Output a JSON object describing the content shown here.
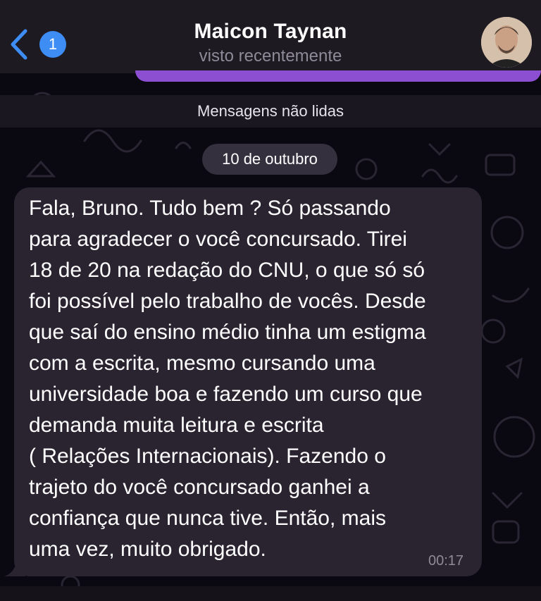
{
  "header": {
    "back_badge": "1",
    "contact_name": "Maicon Taynan",
    "status": "visto recentemente"
  },
  "chat": {
    "unread_divider": "Mensagens não lidas",
    "date": "10 de outubro",
    "message": {
      "lines": [
        "Fala, Bruno. Tudo bem ? Só passando",
        "para agradecer o você concursado. Tirei",
        "18 de 20 na redação do CNU, o que só só",
        "foi possível pelo trabalho de vocês. Desde",
        "que saí do ensino médio tinha um estigma",
        "com a escrita, mesmo cursando uma",
        "universidade boa e fazendo um curso que",
        "demanda muita leitura e escrita",
        "( Relações Internacionais). Fazendo o",
        "trajeto do você concursado ganhei a",
        "confiança que nunca tive. Então, mais",
        "uma vez, muito obrigado."
      ],
      "time": "00:17"
    }
  },
  "colors": {
    "accent": "#3d8df5",
    "outgoing_bubble": "#8c4fd2",
    "incoming_bubble": "#2a2431"
  }
}
